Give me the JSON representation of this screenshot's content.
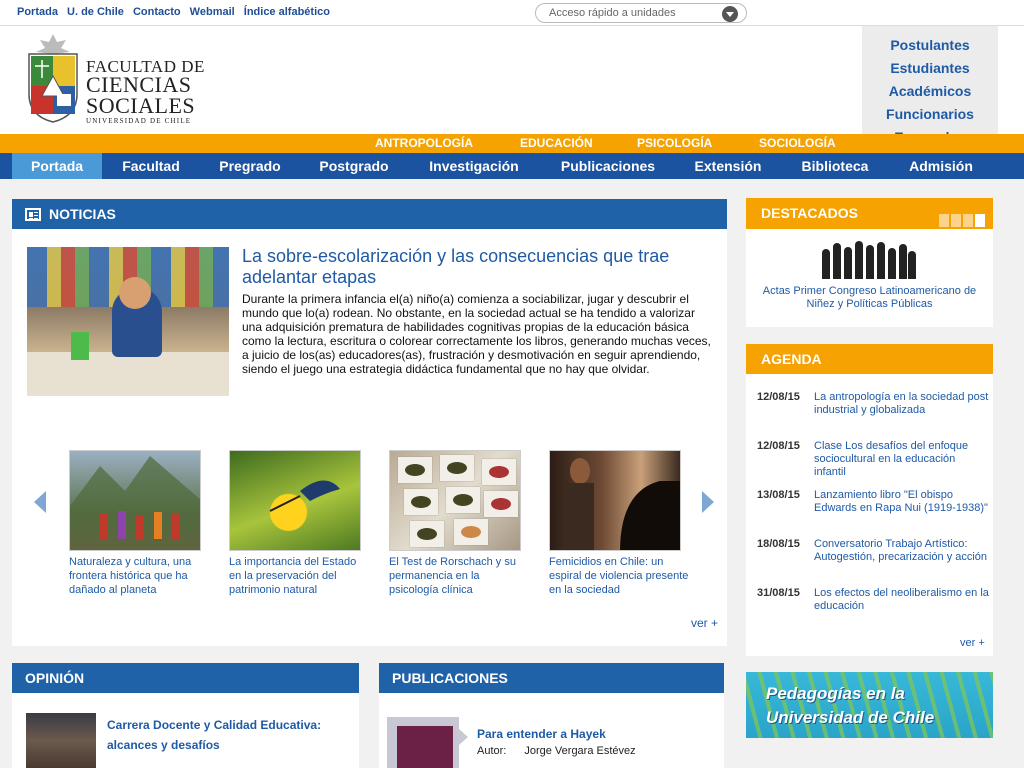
{
  "topbar": {
    "links": [
      "Portada",
      "U. de Chile",
      "Contacto",
      "Webmail",
      "Índice alfabético"
    ],
    "quick_access": "Acceso rápido a unidades"
  },
  "logo": {
    "line1": "FACULTAD DE",
    "line2": "CIENCIAS",
    "line3": "SOCIALES",
    "line4": "UNIVERSIDAD DE CHILE"
  },
  "profiles": [
    "Postulantes",
    "Estudiantes",
    "Académicos",
    "Funcionarios",
    "Egresados"
  ],
  "departments": [
    "ANTROPOLOGÍA",
    "EDUCACIÓN",
    "PSICOLOGÍA",
    "SOCIOLOGÍA"
  ],
  "nav": [
    "Portada",
    "Facultad",
    "Pregrado",
    "Postgrado",
    "Investigación",
    "Publicaciones",
    "Extensión",
    "Biblioteca",
    "Admisión"
  ],
  "noticias": {
    "heading": "NOTICIAS",
    "main_title": "La sobre-escolarización y las consecuencias que trae adelantar etapas",
    "main_text": "Durante la primera infancia el(a) niño(a) comienza a sociabilizar, jugar y descubrir el mundo que lo(a) rodean. No obstante, en la sociedad actual se ha tendido a valorizar una adquisición prematura de habilidades cognitivas propias de la educación básica como la lectura, escritura o colorear correctamente los libros, generando muchas veces, a juicio de los(as) educadores(as), frustración y desmotivación en seguir aprendiendo, siendo el juego una estrategia didáctica fundamental que no hay que olvidar.",
    "items": [
      "Naturaleza y cultura, una frontera histórica que ha dañado al planeta",
      "La importancia del Estado en la preservación del patrimonio natural",
      "El Test de Rorschach y su permanencia en la psicología clínica",
      "Femicidios en Chile: un espiral de violencia presente en la sociedad"
    ],
    "more": "ver +"
  },
  "destacados": {
    "heading": "DESTACADOS",
    "caption": "Actas Primer Congreso Latinoamericano de Niñez y Políticas Públicas"
  },
  "agenda": {
    "heading": "AGENDA",
    "items": [
      {
        "date": "12/08/15",
        "title": "La antropología en la sociedad post industrial y globalizada"
      },
      {
        "date": "12/08/15",
        "title": "Clase Los desafíos del enfoque sociocultural en la educación infantil"
      },
      {
        "date": "13/08/15",
        "title": "Lanzamiento libro \"El obispo Edwards en Rapa Nui (1919-1938)\""
      },
      {
        "date": "18/08/15",
        "title": "Conversatorio Trabajo Artístico: Autogestión, precarización y acción"
      },
      {
        "date": "31/08/15",
        "title": "Los efectos del neoliberalismo en la educación"
      }
    ],
    "more": "ver +"
  },
  "banner": {
    "line1": "Pedagogías en la",
    "line2": "Universidad de Chile"
  },
  "opinion": {
    "heading": "OPINIÓN",
    "title": "Carrera Docente y Calidad Educativa: alcances y desafíos"
  },
  "publicaciones": {
    "heading": "PUBLICACIONES",
    "title": "Para entender a Hayek",
    "author_label": "Autor:",
    "author": "Jorge Vergara Estévez"
  }
}
